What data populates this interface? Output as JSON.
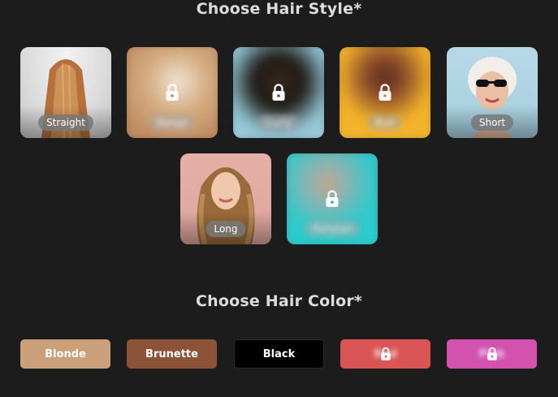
{
  "hair_style": {
    "title": "Choose Hair Style*",
    "tiles": [
      {
        "label": "Straight",
        "locked": false
      },
      {
        "label": "Bangs",
        "locked": true
      },
      {
        "label": "Curly",
        "locked": true
      },
      {
        "label": "Bun",
        "locked": true
      },
      {
        "label": "Short",
        "locked": false
      },
      {
        "label": "Long",
        "locked": false
      },
      {
        "label": "Ponytail",
        "locked": true
      }
    ]
  },
  "hair_color": {
    "title": "Choose Hair Color*",
    "options": [
      {
        "label": "Blonde",
        "color": "#c9a07a",
        "locked": false
      },
      {
        "label": "Brunette",
        "color": "#8d5339",
        "locked": false
      },
      {
        "label": "Black",
        "color": "#000000",
        "locked": false
      },
      {
        "label": "Red",
        "color": "#d95555",
        "locked": true
      },
      {
        "label": "Pink",
        "color": "#d352b0",
        "locked": true
      }
    ]
  },
  "icons": {
    "lock": "lock-icon"
  }
}
